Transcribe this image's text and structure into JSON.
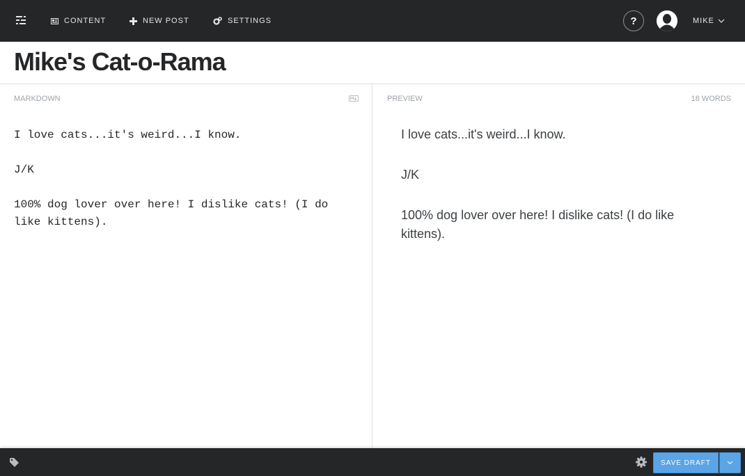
{
  "nav": {
    "items": [
      {
        "label": "CONTENT",
        "icon": "content-icon"
      },
      {
        "label": "NEW POST",
        "icon": "plus-icon"
      },
      {
        "label": "SETTINGS",
        "icon": "gears-icon"
      }
    ],
    "help_label": "?",
    "user_label": "MIKE"
  },
  "post": {
    "title": "Mike's Cat-o-Rama"
  },
  "editor": {
    "markdown_label": "MARKDOWN",
    "preview_label": "PREVIEW",
    "word_count": "18 WORDS",
    "markdown_paragraphs": [
      "I love cats...it's weird...I know.",
      "J/K",
      "100% dog lover over here! I dislike cats! (I do like kittens)."
    ],
    "preview_paragraphs": [
      "I love cats...it's weird...I know.",
      "J/K",
      "100% dog lover over here! I dislike cats! (I do like kittens)."
    ]
  },
  "footer": {
    "save_label": "SAVE DRAFT"
  },
  "colors": {
    "bar_background": "#242628",
    "accent_blue": "#5ba4e5",
    "divider": "#e1e1e1",
    "muted_text": "#9ea3a8"
  }
}
